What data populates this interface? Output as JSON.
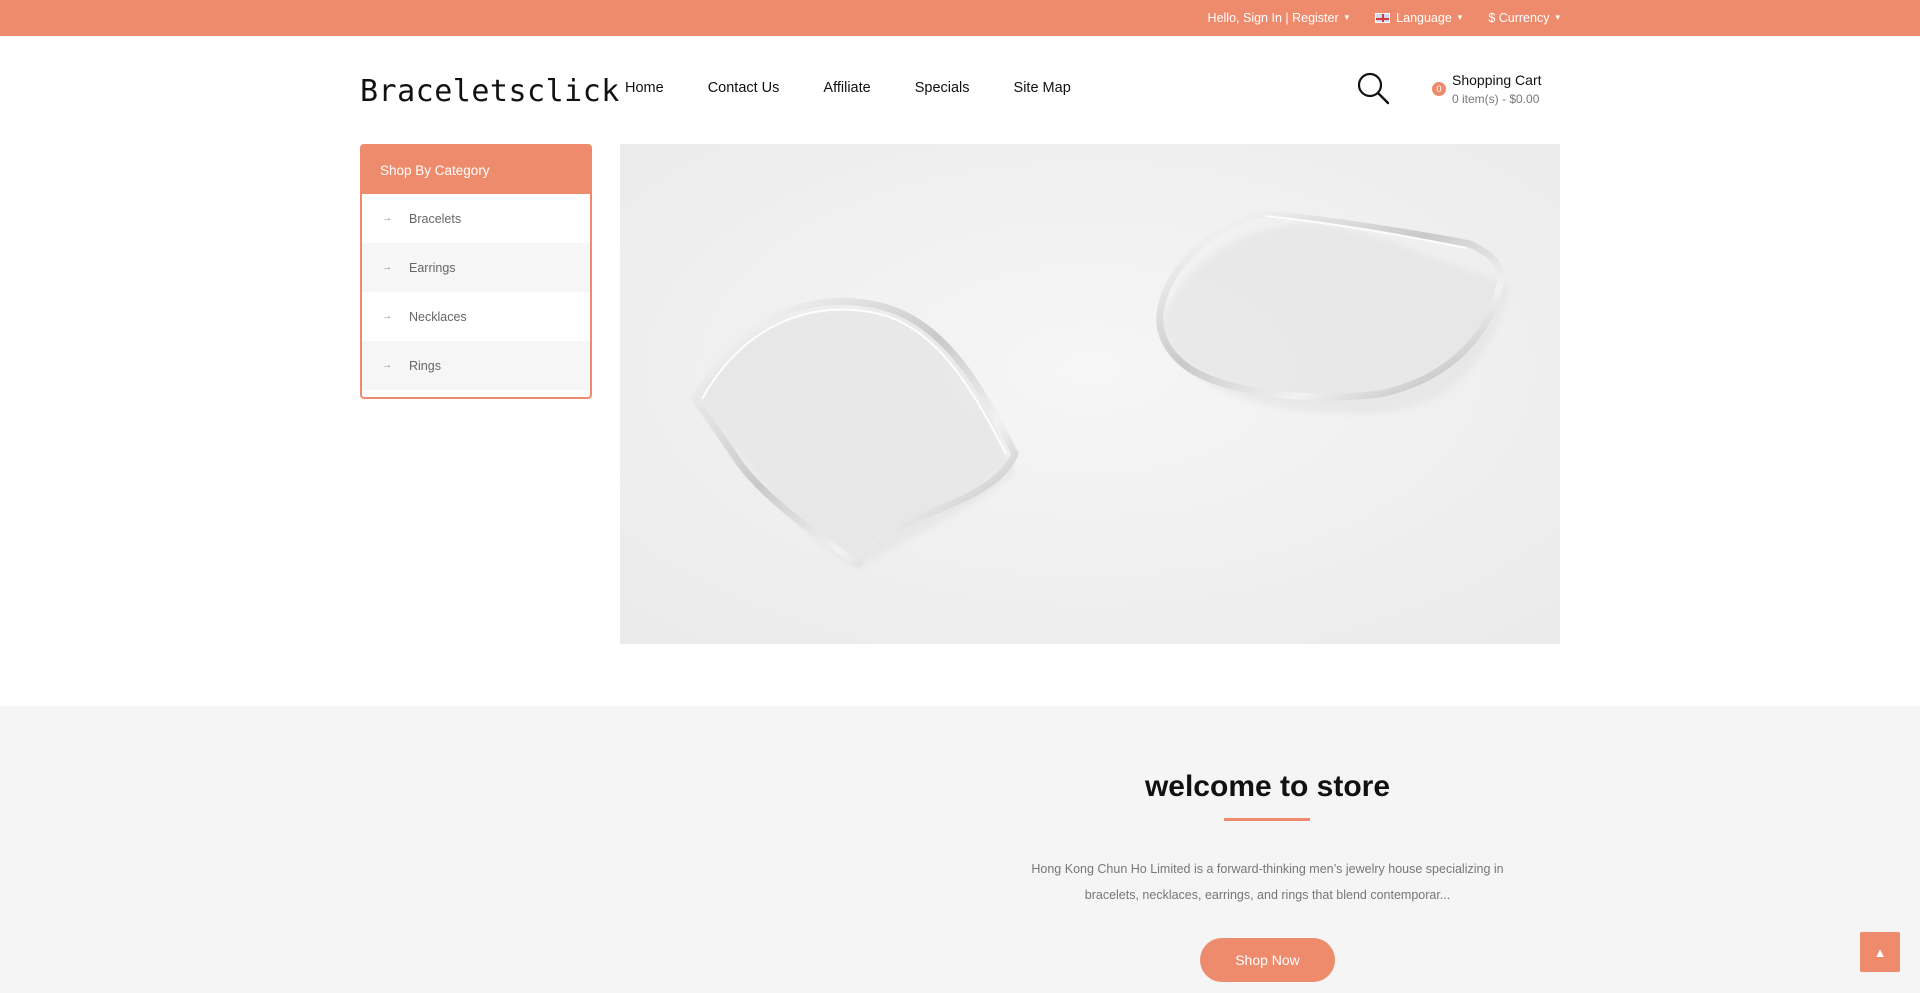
{
  "topbar": {
    "account": "Hello, Sign In | Register",
    "language": "Language",
    "currency": "$ Currency"
  },
  "header": {
    "logo": "Braceletsclick",
    "nav": [
      "Home",
      "Contact Us",
      "Affiliate",
      "Specials",
      "Site Map"
    ],
    "cart": {
      "count": "0",
      "title": "Shopping Cart",
      "summary": "0 item(s) - $0.00"
    }
  },
  "sidebar": {
    "title": "Shop By Category",
    "items": [
      "Bracelets",
      "Earrings",
      "Necklaces",
      "Rings"
    ]
  },
  "welcome": {
    "title": "welcome to store",
    "text": "Hong Kong Chun Ho Limited is a forward-thinking men’s jewelry house specializing in bracelets, necklaces, earrings, and rings that blend contemporar...",
    "button": "Shop Now"
  },
  "colors": {
    "accent": "#ee8b6c",
    "section_bg": "#f5f5f5"
  },
  "icons": [
    "caret-down-icon",
    "flag-icon",
    "search-icon",
    "arrow-right-icon",
    "chevron-up-icon"
  ]
}
